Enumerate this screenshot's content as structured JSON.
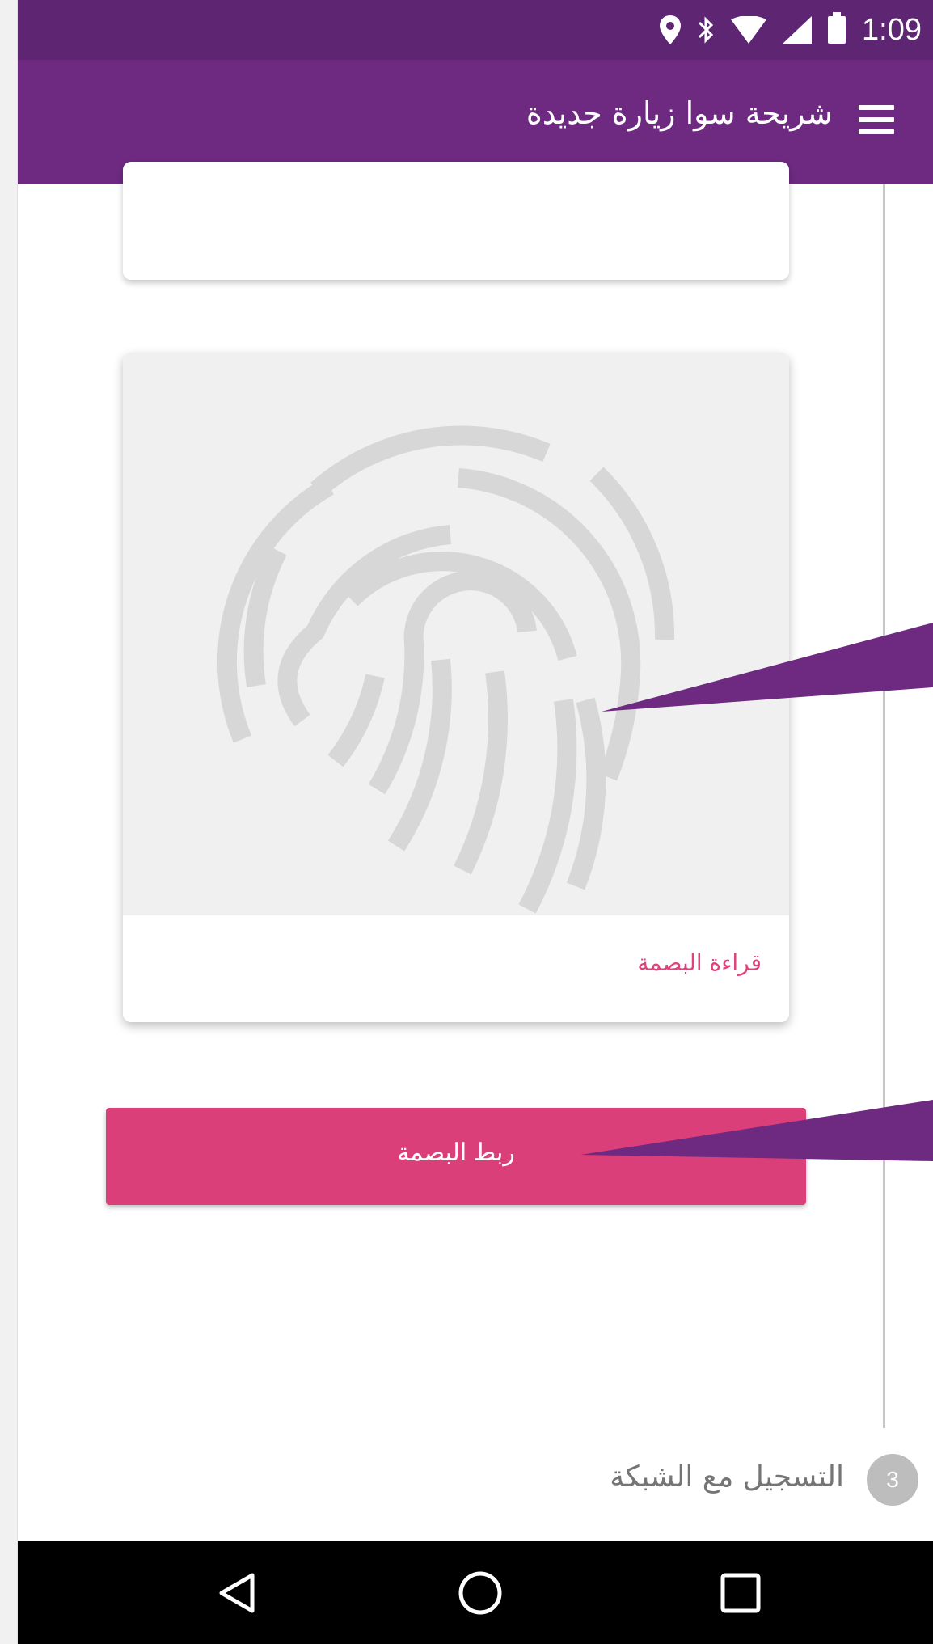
{
  "status_bar": {
    "time": "1:09",
    "icons": [
      "location-icon",
      "bluetooth-icon",
      "wifi-icon",
      "signal-icon",
      "battery-icon"
    ]
  },
  "app_bar": {
    "title": "شريحة سوا زيارة جديدة",
    "menu_icon": "menu-icon",
    "color": "#6d2a80"
  },
  "fingerprint_card": {
    "image_icon": "fingerprint-icon",
    "link_label": "قراءة البصمة",
    "link_color": "#e0437b"
  },
  "link_button": {
    "label": "ربط البصمة",
    "color": "#db3f7a"
  },
  "step": {
    "number": "3",
    "label": "التسجيل مع الشبكة"
  },
  "nav_bar": {
    "buttons": [
      "back-icon",
      "home-icon",
      "recents-icon"
    ]
  },
  "colors": {
    "status_bar": "#5e2573",
    "app_bar": "#6d2a80",
    "accent": "#db3f7a",
    "callout": "#6d2a80"
  }
}
